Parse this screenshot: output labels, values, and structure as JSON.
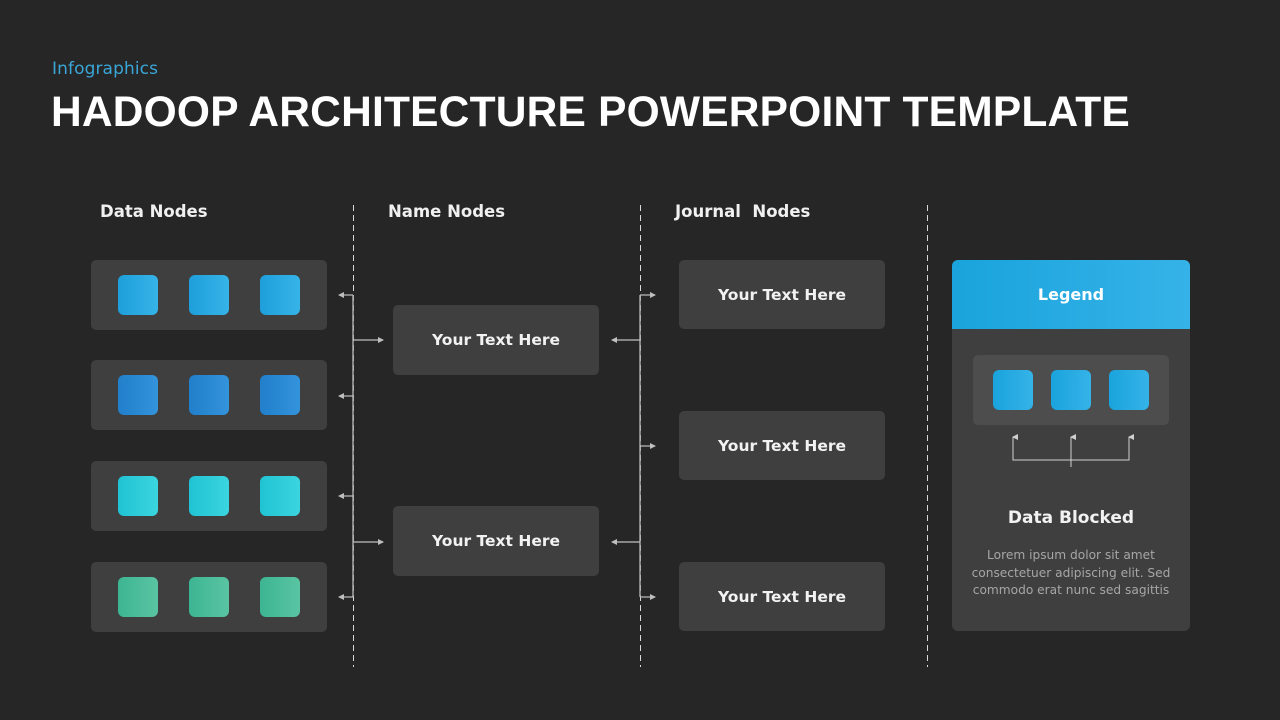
{
  "header": {
    "subtitle": "Infographics",
    "title": "HADOOP ARCHITECTURE POWERPOINT TEMPLATE"
  },
  "columns": {
    "data_nodes": "Data Nodes",
    "name_nodes": "Name Nodes",
    "journal_nodes": "Journal  Nodes"
  },
  "data_node_rows": [
    {
      "color_start": "#1e9fdb",
      "color_end": "#36b4e8",
      "blocks": 3
    },
    {
      "color_start": "#217fcb",
      "color_end": "#3393db",
      "blocks": 3
    },
    {
      "color_start": "#20c3d3",
      "color_end": "#3bd5df",
      "blocks": 3
    },
    {
      "color_start": "#3db592",
      "color_end": "#5ac4a2",
      "blocks": 3
    }
  ],
  "name_nodes": [
    {
      "label": "Your Text Here"
    },
    {
      "label": "Your Text Here"
    }
  ],
  "journal_nodes": [
    {
      "label": "Your Text Here"
    },
    {
      "label": "Your Text Here"
    },
    {
      "label": "Your Text Here"
    }
  ],
  "legend": {
    "title": "Legend",
    "accent_start": "#1aa3dc",
    "accent_end": "#35b3e8",
    "block_title": "Data Blocked",
    "block_description": "Lorem ipsum dolor sit amet consectetuer adipiscing elit. Sed commodo erat nunc sed sagittis"
  },
  "colors": {
    "background": "#262626",
    "card": "#3f3f3f",
    "connector": "#bfbfbf"
  }
}
